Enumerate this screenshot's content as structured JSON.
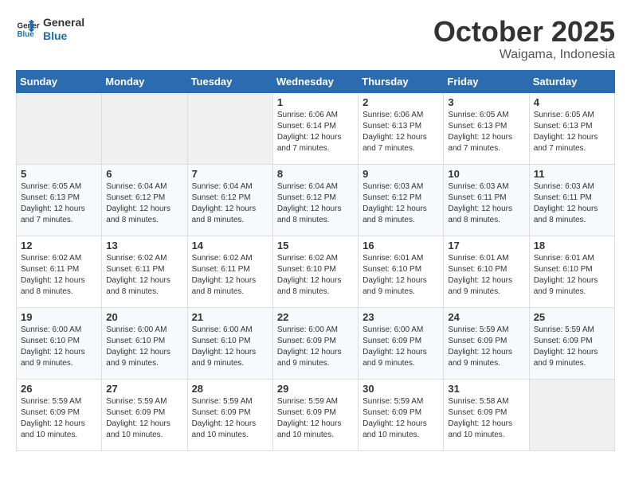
{
  "header": {
    "logo_line1": "General",
    "logo_line2": "Blue",
    "month": "October 2025",
    "location": "Waigama, Indonesia"
  },
  "weekdays": [
    "Sunday",
    "Monday",
    "Tuesday",
    "Wednesday",
    "Thursday",
    "Friday",
    "Saturday"
  ],
  "weeks": [
    [
      {
        "day": "",
        "detail": ""
      },
      {
        "day": "",
        "detail": ""
      },
      {
        "day": "",
        "detail": ""
      },
      {
        "day": "1",
        "detail": "Sunrise: 6:06 AM\nSunset: 6:14 PM\nDaylight: 12 hours\nand 7 minutes."
      },
      {
        "day": "2",
        "detail": "Sunrise: 6:06 AM\nSunset: 6:13 PM\nDaylight: 12 hours\nand 7 minutes."
      },
      {
        "day": "3",
        "detail": "Sunrise: 6:05 AM\nSunset: 6:13 PM\nDaylight: 12 hours\nand 7 minutes."
      },
      {
        "day": "4",
        "detail": "Sunrise: 6:05 AM\nSunset: 6:13 PM\nDaylight: 12 hours\nand 7 minutes."
      }
    ],
    [
      {
        "day": "5",
        "detail": "Sunrise: 6:05 AM\nSunset: 6:13 PM\nDaylight: 12 hours\nand 7 minutes."
      },
      {
        "day": "6",
        "detail": "Sunrise: 6:04 AM\nSunset: 6:12 PM\nDaylight: 12 hours\nand 8 minutes."
      },
      {
        "day": "7",
        "detail": "Sunrise: 6:04 AM\nSunset: 6:12 PM\nDaylight: 12 hours\nand 8 minutes."
      },
      {
        "day": "8",
        "detail": "Sunrise: 6:04 AM\nSunset: 6:12 PM\nDaylight: 12 hours\nand 8 minutes."
      },
      {
        "day": "9",
        "detail": "Sunrise: 6:03 AM\nSunset: 6:12 PM\nDaylight: 12 hours\nand 8 minutes."
      },
      {
        "day": "10",
        "detail": "Sunrise: 6:03 AM\nSunset: 6:11 PM\nDaylight: 12 hours\nand 8 minutes."
      },
      {
        "day": "11",
        "detail": "Sunrise: 6:03 AM\nSunset: 6:11 PM\nDaylight: 12 hours\nand 8 minutes."
      }
    ],
    [
      {
        "day": "12",
        "detail": "Sunrise: 6:02 AM\nSunset: 6:11 PM\nDaylight: 12 hours\nand 8 minutes."
      },
      {
        "day": "13",
        "detail": "Sunrise: 6:02 AM\nSunset: 6:11 PM\nDaylight: 12 hours\nand 8 minutes."
      },
      {
        "day": "14",
        "detail": "Sunrise: 6:02 AM\nSunset: 6:11 PM\nDaylight: 12 hours\nand 8 minutes."
      },
      {
        "day": "15",
        "detail": "Sunrise: 6:02 AM\nSunset: 6:10 PM\nDaylight: 12 hours\nand 8 minutes."
      },
      {
        "day": "16",
        "detail": "Sunrise: 6:01 AM\nSunset: 6:10 PM\nDaylight: 12 hours\nand 9 minutes."
      },
      {
        "day": "17",
        "detail": "Sunrise: 6:01 AM\nSunset: 6:10 PM\nDaylight: 12 hours\nand 9 minutes."
      },
      {
        "day": "18",
        "detail": "Sunrise: 6:01 AM\nSunset: 6:10 PM\nDaylight: 12 hours\nand 9 minutes."
      }
    ],
    [
      {
        "day": "19",
        "detail": "Sunrise: 6:00 AM\nSunset: 6:10 PM\nDaylight: 12 hours\nand 9 minutes."
      },
      {
        "day": "20",
        "detail": "Sunrise: 6:00 AM\nSunset: 6:10 PM\nDaylight: 12 hours\nand 9 minutes."
      },
      {
        "day": "21",
        "detail": "Sunrise: 6:00 AM\nSunset: 6:10 PM\nDaylight: 12 hours\nand 9 minutes."
      },
      {
        "day": "22",
        "detail": "Sunrise: 6:00 AM\nSunset: 6:09 PM\nDaylight: 12 hours\nand 9 minutes."
      },
      {
        "day": "23",
        "detail": "Sunrise: 6:00 AM\nSunset: 6:09 PM\nDaylight: 12 hours\nand 9 minutes."
      },
      {
        "day": "24",
        "detail": "Sunrise: 5:59 AM\nSunset: 6:09 PM\nDaylight: 12 hours\nand 9 minutes."
      },
      {
        "day": "25",
        "detail": "Sunrise: 5:59 AM\nSunset: 6:09 PM\nDaylight: 12 hours\nand 9 minutes."
      }
    ],
    [
      {
        "day": "26",
        "detail": "Sunrise: 5:59 AM\nSunset: 6:09 PM\nDaylight: 12 hours\nand 10 minutes."
      },
      {
        "day": "27",
        "detail": "Sunrise: 5:59 AM\nSunset: 6:09 PM\nDaylight: 12 hours\nand 10 minutes."
      },
      {
        "day": "28",
        "detail": "Sunrise: 5:59 AM\nSunset: 6:09 PM\nDaylight: 12 hours\nand 10 minutes."
      },
      {
        "day": "29",
        "detail": "Sunrise: 5:59 AM\nSunset: 6:09 PM\nDaylight: 12 hours\nand 10 minutes."
      },
      {
        "day": "30",
        "detail": "Sunrise: 5:59 AM\nSunset: 6:09 PM\nDaylight: 12 hours\nand 10 minutes."
      },
      {
        "day": "31",
        "detail": "Sunrise: 5:58 AM\nSunset: 6:09 PM\nDaylight: 12 hours\nand 10 minutes."
      },
      {
        "day": "",
        "detail": ""
      }
    ]
  ]
}
